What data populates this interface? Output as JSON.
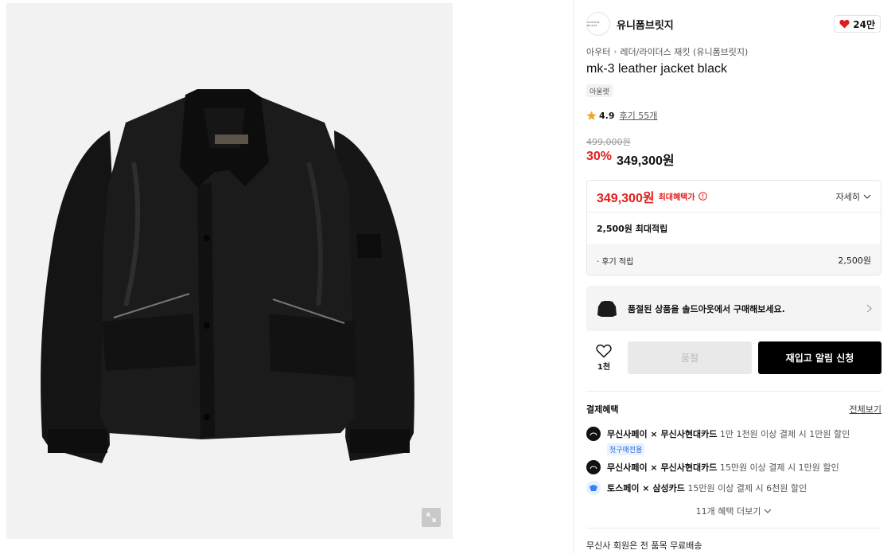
{
  "brand": {
    "name": "유니폼브릿지",
    "logo_text": "UNIFORM BRIDGE"
  },
  "likes": {
    "count": "24만"
  },
  "breadcrumb": {
    "category": "아우터",
    "subcategory": "레더/라이더스 재킷 (유니폼브릿지)"
  },
  "product": {
    "title": "mk-3 leather jacket black",
    "tag": "아울렛",
    "rating": "4.9",
    "reviews": "후기 55개",
    "original_price": "499,000원",
    "discount": "30%",
    "price": "349,300원"
  },
  "benefit": {
    "max_price": "349,300원",
    "max_label": "최대혜택가",
    "detail_label": "자세히",
    "points_label": "2,500원 최대적립",
    "review_points_label": "· 후기 적립",
    "review_points_amount": "2,500원"
  },
  "soldout_banner": {
    "text": "품절된 상품을 솔드아웃에서 구매해보세요."
  },
  "actions": {
    "wish_count": "1천",
    "soldout_label": "품절",
    "restock_label": "재입고 알림 신청"
  },
  "payment": {
    "title": "결제혜택",
    "view_all": "전체보기",
    "items": [
      {
        "provider": "무신사페이 × 무신사현대카드",
        "desc": " 1만 1천원 이상 결제 시 1만원 할인",
        "tag": "첫구매전용",
        "logo_color": "#111111"
      },
      {
        "provider": "무신사페이 × 무신사현대카드",
        "desc": " 15만원 이상 결제 시 1만원 할인",
        "logo_color": "#111111"
      },
      {
        "provider": "토스페이 × 삼성카드",
        "desc": " 15만원 이상 결제 시 6천원 할인",
        "logo_color": "#3182f6"
      }
    ],
    "more_label": "11개 혜택 더보기"
  },
  "shipping": {
    "text": "무신사 회원은 전 품목 무료배송"
  },
  "colors": {
    "sale_red": "#e01e1e",
    "accent_black": "#000000",
    "tag_blue": "#2d6ddb"
  }
}
